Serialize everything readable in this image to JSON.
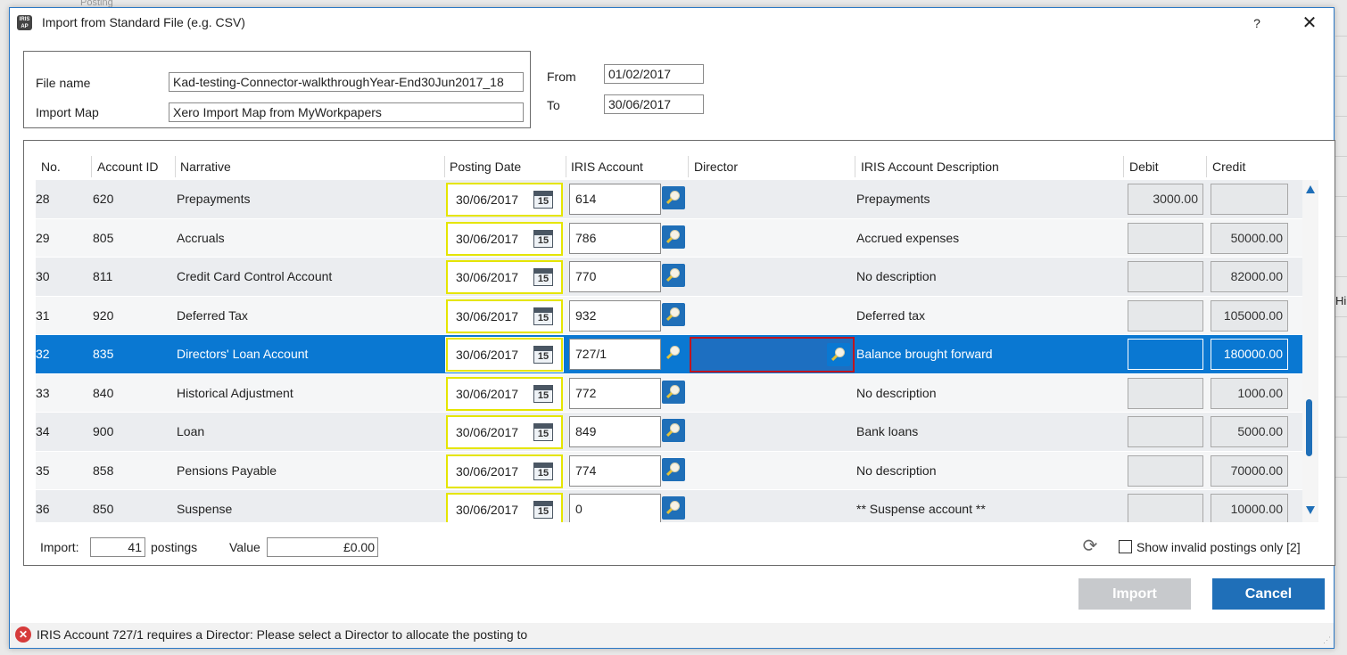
{
  "background": {
    "top_text": "Posting",
    "right_text": "Hi"
  },
  "dialog": {
    "title": "Import from Standard File (e.g. CSV)",
    "app_icon_text": "IRIS AP",
    "help": "?",
    "close": "✕"
  },
  "file": {
    "file_name_label": "File name",
    "file_name_value": "Kad-testing-Connector-walkthroughYear-End30Jun2017_18",
    "import_map_label": "Import Map",
    "import_map_value": "Xero Import Map from MyWorkpapers",
    "from_label": "From",
    "from_value": "01/02/2017",
    "to_label": "To",
    "to_value": "30/06/2017"
  },
  "grid": {
    "headers": [
      "No.",
      "Account ID",
      "Narrative",
      "Posting Date",
      "IRIS Account",
      "Director",
      "IRIS Account Description",
      "Debit",
      "Credit"
    ],
    "calendar_day": "15",
    "rows": [
      {
        "no": "28",
        "account_id": "620",
        "narrative": "Prepayments",
        "date": "30/06/2017",
        "iris": "614",
        "director": "",
        "description": "Prepayments",
        "debit": "3000.00",
        "credit": ""
      },
      {
        "no": "29",
        "account_id": "805",
        "narrative": "Accruals",
        "date": "30/06/2017",
        "iris": "786",
        "director": "",
        "description": "Accrued expenses",
        "debit": "",
        "credit": "50000.00"
      },
      {
        "no": "30",
        "account_id": "811",
        "narrative": "Credit Card Control Account",
        "date": "30/06/2017",
        "iris": "770",
        "director": "",
        "description": "No description",
        "debit": "",
        "credit": "82000.00"
      },
      {
        "no": "31",
        "account_id": "920",
        "narrative": "Deferred Tax",
        "date": "30/06/2017",
        "iris": "932",
        "director": "",
        "description": "Deferred tax",
        "debit": "",
        "credit": "105000.00"
      },
      {
        "no": "32",
        "account_id": "835",
        "narrative": "Directors' Loan Account",
        "date": "30/06/2017",
        "iris": "727/1",
        "director": "",
        "description": "Balance brought forward",
        "debit": "",
        "credit": "180000.00"
      },
      {
        "no": "33",
        "account_id": "840",
        "narrative": "Historical Adjustment",
        "date": "30/06/2017",
        "iris": "772",
        "director": "",
        "description": "No description",
        "debit": "",
        "credit": "1000.00"
      },
      {
        "no": "34",
        "account_id": "900",
        "narrative": "Loan",
        "date": "30/06/2017",
        "iris": "849",
        "director": "",
        "description": "Bank loans",
        "debit": "",
        "credit": "5000.00"
      },
      {
        "no": "35",
        "account_id": "858",
        "narrative": "Pensions Payable",
        "date": "30/06/2017",
        "iris": "774",
        "director": "",
        "description": "No description",
        "debit": "",
        "credit": "70000.00"
      },
      {
        "no": "36",
        "account_id": "850",
        "narrative": "Suspense",
        "date": "30/06/2017",
        "iris": "0",
        "director": "",
        "description": "** Suspense account **",
        "debit": "",
        "credit": "10000.00"
      }
    ]
  },
  "footer": {
    "import_label": "Import:",
    "import_count": "41",
    "postings_label": "postings",
    "value_label": "Value",
    "value_amount": "£0.00",
    "show_invalid_label": "Show invalid postings only [2]"
  },
  "buttons": {
    "import": "Import",
    "cancel": "Cancel"
  },
  "status": {
    "message": "IRIS Account 727/1 requires a Director: Please select a Director to allocate the posting to"
  }
}
